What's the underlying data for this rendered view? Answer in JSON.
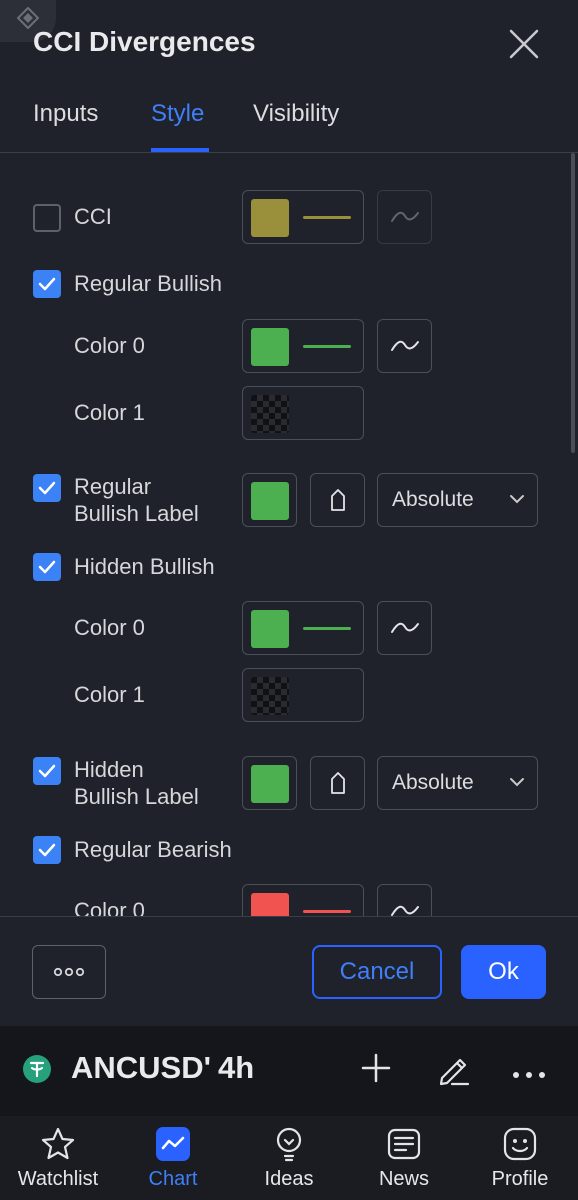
{
  "dialog": {
    "title": "CCI Divergences",
    "tabs": [
      {
        "label": "Inputs",
        "active": false
      },
      {
        "label": "Style",
        "active": true
      },
      {
        "label": "Visibility",
        "active": false
      }
    ]
  },
  "style_rows": [
    {
      "label": "CCI",
      "checked": false,
      "color": "#9a8f3b"
    },
    {
      "label": "Regular Bullish",
      "checked": true
    },
    {
      "label": "Color 0",
      "color": "#4caf50"
    },
    {
      "label": "Color 1",
      "color": "transparent"
    },
    {
      "label_line1": "Regular",
      "label_line2": "Bullish Label",
      "checked": true,
      "color": "#4caf50",
      "position": "Absolute"
    },
    {
      "label": "Hidden Bullish",
      "checked": true
    },
    {
      "label": "Color 0",
      "color": "#4caf50"
    },
    {
      "label": "Color 1",
      "color": "transparent"
    },
    {
      "label_line1": "Hidden",
      "label_line2": "Bullish Label",
      "checked": true,
      "color": "#4caf50",
      "position": "Absolute"
    },
    {
      "label": "Regular Bearish",
      "checked": true
    },
    {
      "label": "Color 0",
      "color": "#f05350"
    }
  ],
  "footer": {
    "more_label": "◦◦◦",
    "cancel_label": "Cancel",
    "ok_label": "Ok"
  },
  "symbol_bar": {
    "symbol": "ANCUSD'",
    "interval": "4h"
  },
  "bottom_nav": [
    {
      "label": "Watchlist",
      "icon": "star-icon",
      "active": false
    },
    {
      "label": "Chart",
      "icon": "chart-icon",
      "active": true
    },
    {
      "label": "Ideas",
      "icon": "lightbulb-icon",
      "active": false
    },
    {
      "label": "News",
      "icon": "news-icon",
      "active": false
    },
    {
      "label": "Profile",
      "icon": "smiley-icon",
      "active": false
    }
  ],
  "colors": {
    "accent": "#2962ff",
    "background": "#1f222a",
    "green": "#4caf50",
    "red": "#f05350",
    "olive": "#9a8f3b"
  }
}
